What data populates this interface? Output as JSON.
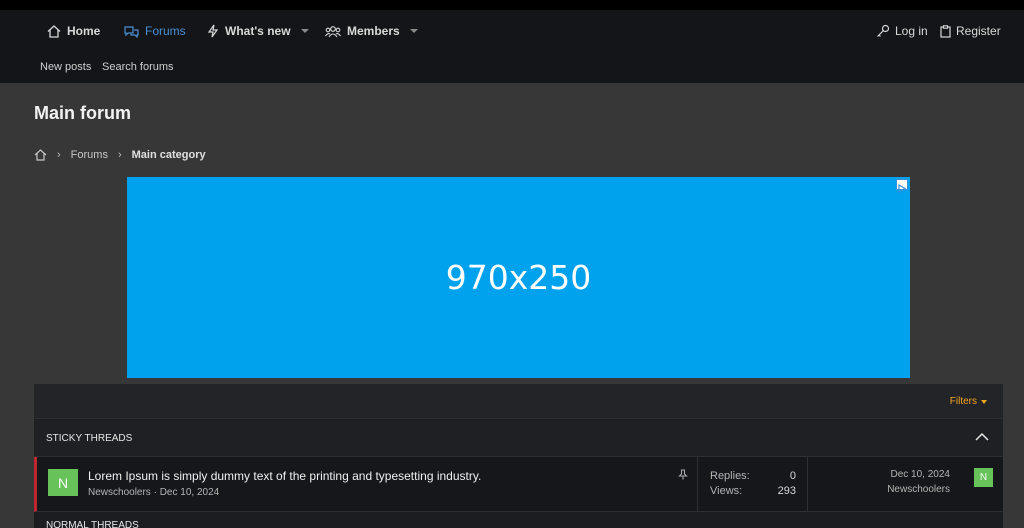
{
  "nav": {
    "home": "Home",
    "forums": "Forums",
    "whats_new": "What's new",
    "members": "Members",
    "login": "Log in",
    "register": "Register"
  },
  "subnav": {
    "new_posts": "New posts",
    "search_forums": "Search forums"
  },
  "page": {
    "title": "Main forum"
  },
  "breadcrumb": {
    "forums": "Forums",
    "current": "Main category"
  },
  "ad": {
    "label": "970x250"
  },
  "panel": {
    "filters": "Filters",
    "sticky_header": "STICKY THREADS",
    "normal_header": "NORMAL THREADS"
  },
  "thread": {
    "title": "Lorem Ipsum is simply dummy text of the printing and typesetting industry.",
    "author": "Newschoolers",
    "date": "Dec 10, 2024",
    "avatar_letter": "N",
    "replies_label": "Replies:",
    "replies": "0",
    "views_label": "Views:",
    "views": "293",
    "last_date": "Dec 10, 2024",
    "last_user": "Newschoolers",
    "last_avatar_letter": "N"
  },
  "colors": {
    "accent": "#4a8fd6",
    "filters": "#f5a623",
    "ad_bg": "#00a2ee",
    "avatar": "#67c25a",
    "sticky_marker": "#c0262d"
  }
}
